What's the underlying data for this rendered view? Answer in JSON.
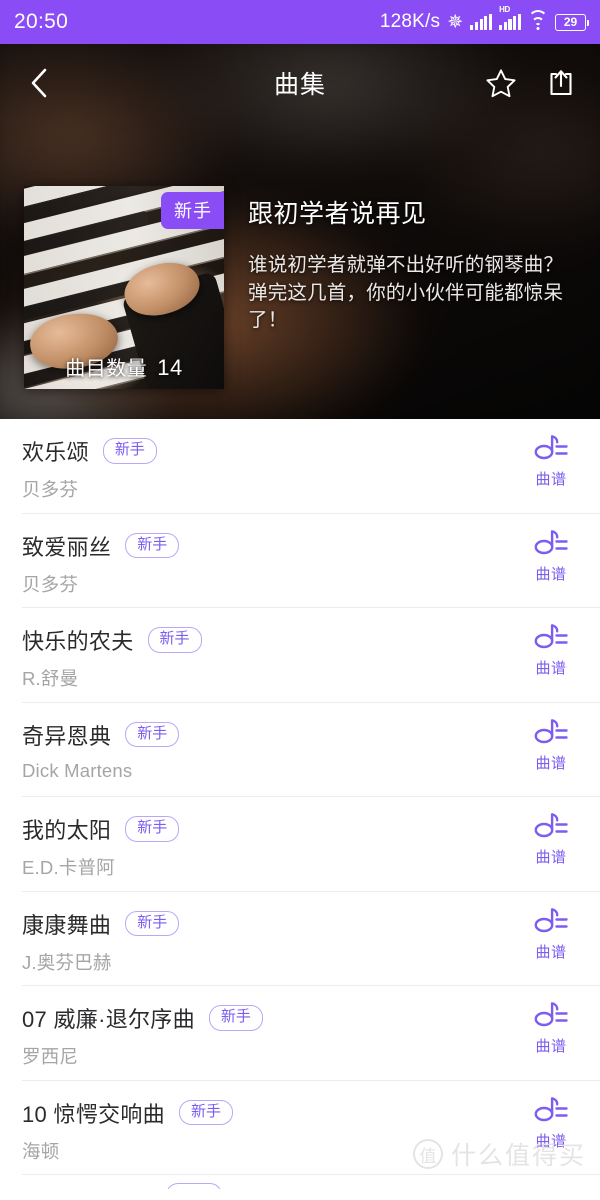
{
  "statusbar": {
    "clock": "20:50",
    "netspeed": "128K/s",
    "bluetooth_icon": "bluetooth-icon",
    "signal_icon": "signal-bars-icon",
    "hd_label": "HD",
    "hd_signal_icon": "hd-signal-bars-icon",
    "wifi_icon": "wifi-icon",
    "battery_level": "29",
    "accent": "#8a4df5"
  },
  "navbar": {
    "back_icon": "chevron-left-icon",
    "title": "曲集",
    "favorite_icon": "star-icon",
    "share_icon": "share-icon"
  },
  "hero": {
    "badge": "新手",
    "count_label": "曲目数量",
    "count_value": "14",
    "title": "跟初学者说再见",
    "description": "谁说初学者就弹不出好听的钢琴曲？弹完这几首，你的小伙伴可能都惊呆了！",
    "thumbnail_icon": "piano-hands-photo"
  },
  "list": {
    "action_icon": "music-note-icon",
    "action_label": "曲谱",
    "badge_label": "新手",
    "items": [
      {
        "title": "欢乐颂",
        "artist": "贝多芬",
        "badge": "新手",
        "action": "曲谱"
      },
      {
        "title": "致爱丽丝",
        "artist": "贝多芬",
        "badge": "新手",
        "action": "曲谱"
      },
      {
        "title": "快乐的农夫",
        "artist": "R.舒曼",
        "badge": "新手",
        "action": "曲谱"
      },
      {
        "title": "奇异恩典",
        "artist": "Dick Martens",
        "badge": "新手",
        "action": "曲谱"
      },
      {
        "title": "我的太阳",
        "artist": "E.D.卡普阿",
        "badge": "新手",
        "action": "曲谱"
      },
      {
        "title": "康康舞曲",
        "artist": "J.奥芬巴赫",
        "badge": "新手",
        "action": "曲谱"
      },
      {
        "title": "07 威廉·退尔序曲",
        "artist": "罗西尼",
        "badge": "新手",
        "action": "曲谱"
      },
      {
        "title": "10 惊愕交响曲",
        "artist": "海顿",
        "badge": "新手",
        "action": "曲谱"
      }
    ]
  },
  "watermark": {
    "mark": "值",
    "text": "什么值得买"
  },
  "colors": {
    "accent_purple": "#8a4df5",
    "link_purple": "#7d5cf0",
    "pill_border": "#b9a8f6",
    "title_text": "#2b2b2e",
    "artist_text": "#a5a5a8",
    "divider": "#ececed"
  }
}
